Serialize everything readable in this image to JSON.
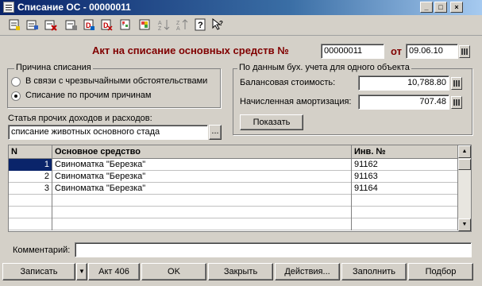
{
  "window": {
    "title": "Списание ОС - 00000011",
    "minimize_glyph": "_",
    "maximize_glyph": "□",
    "close_glyph": "×"
  },
  "toolbar": {
    "icons": [
      "new-document-icon",
      "copy-document-icon",
      "delete-mark-icon",
      "delete-icon",
      "post-document-icon",
      "unpost-document-icon",
      "structure-icon",
      "filter-icon",
      "sort-asc-icon",
      "sort-desc-icon",
      "help-icon",
      "context-help-icon"
    ]
  },
  "header": {
    "doc_label": "Акт на списание основных средств №",
    "number": "00000011",
    "date_label": "от",
    "date": "09.06.10"
  },
  "reason": {
    "group_label": "Причина списания",
    "options": [
      {
        "label": "В связи с чрезвычайными обстоятельствами",
        "selected": false
      },
      {
        "label": "Списание по прочим причинам",
        "selected": true
      }
    ]
  },
  "accounting": {
    "group_label": "По данным бух. учета для одного объекта",
    "balance_label": "Балансовая стоимость:",
    "balance_value": "10,788.80",
    "depreciation_label": "Начисленная амортизация:",
    "depreciation_value": "707.48",
    "show_button": "Показать"
  },
  "income_article": {
    "label": "Статья прочих доходов и расходов:",
    "value": "списание животных основного стада",
    "select_button": "..."
  },
  "table": {
    "columns": [
      "N",
      "Основное средство",
      "Инв. №"
    ],
    "rows": [
      {
        "n": "1",
        "asset": "Свиноматка \"Березка\"",
        "inv": "91162"
      },
      {
        "n": "2",
        "asset": "Свиноматка \"Березка\"",
        "inv": "91163"
      },
      {
        "n": "3",
        "asset": "Свиноматка \"Березка\"",
        "inv": "91164"
      }
    ]
  },
  "comment": {
    "label": "Комментарий:",
    "value": ""
  },
  "buttons": {
    "record": "Записать",
    "dropdown": "▼",
    "act": "Акт 406",
    "ok": "OK",
    "close": "Закрыть",
    "actions": "Действия...",
    "fill": "Заполнить",
    "select": "Подбор"
  },
  "colors": {
    "title_gradient_start": "#0a246a",
    "header_text": "#800000",
    "window_bg": "#d4d0c8"
  }
}
